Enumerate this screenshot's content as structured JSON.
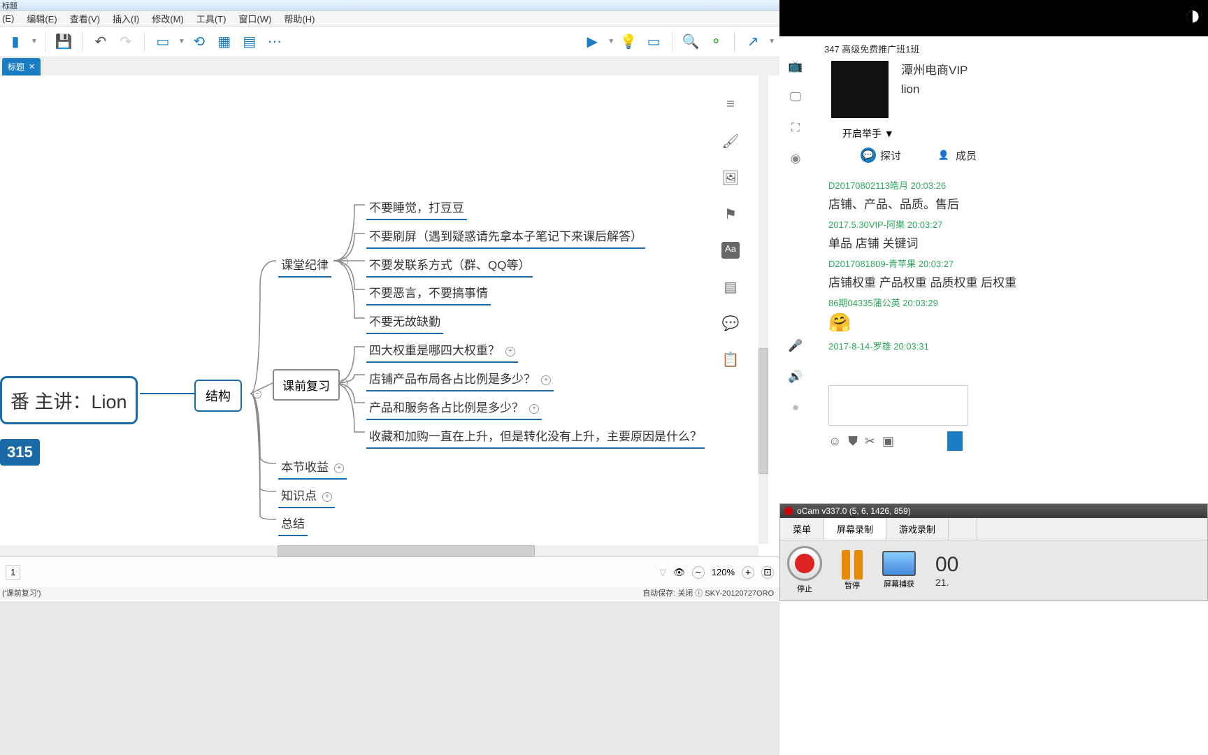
{
  "window": {
    "title": "标题"
  },
  "menu": [
    "(E)",
    "编辑(E)",
    "查看(V)",
    "插入(I)",
    "修改(M)",
    "工具(T)",
    "窗口(W)",
    "帮助(H)"
  ],
  "tab": {
    "label": "标题",
    "close": "✕"
  },
  "mindmap": {
    "root": "番 主讲：Lion",
    "badge": "315",
    "struct": "结构",
    "selected": "课前复习",
    "b1": "课堂纪律",
    "b1c": [
      "不要睡觉，打豆豆",
      "不要刷屏（遇到疑惑请先拿本子笔记下来课后解答）",
      "不要发联系方式（群、QQ等）",
      "不要恶言，不要搞事情",
      "不要无故缺勤"
    ],
    "b2c": [
      "四大权重是哪四大权重？",
      "店铺产品布局各占比例是多少？",
      "产品和服务各占比例是多少？",
      "收藏和加购一直在上升，但是转化没有上升，主要原因是什么？"
    ],
    "b3": "本节收益",
    "b4": "知识点",
    "b5": "总结"
  },
  "status": {
    "page": "1",
    "zoom": "120%",
    "footer_left": "('课前复习')",
    "footer_right": "自动保存: 关闭 ⓘ SKY-20120727ORO"
  },
  "chat": {
    "room": "347 高级免费推广班1班",
    "profile_line1": "潭州电商VIP",
    "profile_line2": "lion",
    "raise_hand": "开启举手 ▼",
    "tab1": "探讨",
    "tab2": "成员",
    "messages": [
      {
        "u": "D20170802113皓月  20:03:26",
        "t": "店铺、产品、品质。售后"
      },
      {
        "u": "2017.5.30VIP-阿樂  20:03:27",
        "t": "单品  店铺  关键词"
      },
      {
        "u": "D2017081809-青苹果  20:03:27",
        "t": "店铺权重 产品权重 品质权重 后权重"
      },
      {
        "u": "86期04335蒲公英  20:03:29",
        "t": "🤗"
      },
      {
        "u": "2017-8-14-罗雄  20:03:31",
        "t": ""
      }
    ]
  },
  "ocam": {
    "title": "oCam v337.0 (5, 6, 1426, 859)",
    "tabs": [
      "菜单",
      "屏幕录制",
      "游戏录制"
    ],
    "btn_stop": "停止",
    "btn_pause": "暂停",
    "btn_capture": "屏幕捕获",
    "time": "00",
    "size": "21."
  }
}
